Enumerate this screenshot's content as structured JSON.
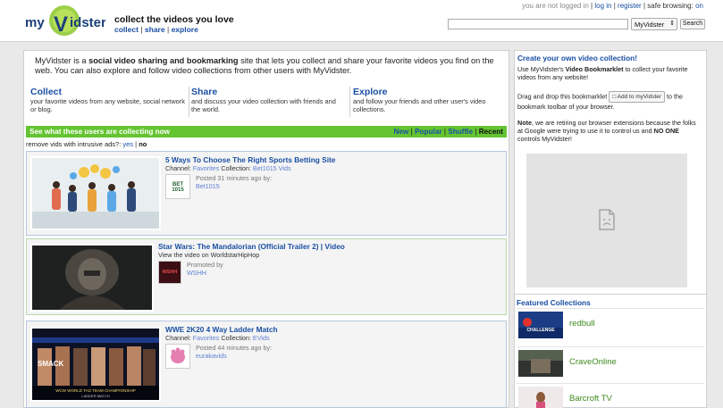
{
  "brand": {
    "logo_text": "myVidster",
    "tagline": "collect the videos you love"
  },
  "nav": {
    "links": [
      "collect",
      "share",
      "explore"
    ],
    "sep": "|"
  },
  "userbar": {
    "status": "you are not logged in",
    "login": "log in",
    "register": "register",
    "safe_label": "safe browsing:",
    "safe_value": "on"
  },
  "search": {
    "placeholder": "",
    "collection_select": "MyVidster",
    "button": "Search"
  },
  "intro": {
    "p1": "MyVidster is a ",
    "bold": "social video sharing and bookmarking",
    "p2": " site that lets you collect and share your favorite videos you find on the web. You can also explore and follow video collections from other users with MyVidster."
  },
  "features": [
    {
      "title": "Collect",
      "desc": "your favorite videos from any website, social network or blog."
    },
    {
      "title": "Share",
      "desc": "and discuss your video collection with friends and the world."
    },
    {
      "title": "Explore",
      "desc": "and follow your friends and other user's video collections."
    }
  ],
  "feed": {
    "header": "See what these users are collecting now",
    "tabs": [
      "New",
      "Popular",
      "Shuffle",
      "Recent"
    ],
    "remove_label": "remove vids with intrusive ads?:",
    "remove_yes": "yes",
    "remove_no": "no"
  },
  "items": [
    {
      "title": "5 Ways To Choose The Right Sports Betting Site",
      "channel_label": "Channel:",
      "channel": "Favorites",
      "collection_label": "Collection:",
      "collection": "Bet1015 Vids",
      "posted": "Posted 31 minutes ago by:",
      "user": "Bet1015",
      "avatar_text": "BET 1015"
    },
    {
      "title": "Star Wars: The Mandalorian (Official Trailer 2) | Video",
      "subtitle": "View the video on WorldstarHipHop",
      "posted": "Promoted by",
      "user": "WSHH",
      "avatar_text": "WSHH"
    },
    {
      "title": "WWE 2K20 4 Way Ladder Match",
      "channel_label": "Channel:",
      "channel": "Favorites",
      "collection_label": "Collection:",
      "collection": "EVids",
      "posted": "Posted 44 minutes ago by:",
      "user": "eurakavids",
      "thumb_caption": "WCW WORLD TAG TEAM CHAMPIONSHIP",
      "thumb_caption2": "LADDER MATCH"
    }
  ],
  "sidebar": {
    "title": "Create your own video collection!",
    "p1a": "Use MyVidster's ",
    "p1b": "Video Bookmarklet",
    "p1c": " to collect your favorite videos from any website!",
    "p2a": "Drag and drop this bookmarklet",
    "bookmarklet": "Add to myVidster",
    "p2b": " to the bookmark toolbar of your browser.",
    "p3a": "Note",
    "p3b": ", we are retiring our browser extensions because the folks at Google were trying to use it to control us and ",
    "p3c": "NO ONE",
    "p3d": " controls MyVidster!",
    "featured_title": "Featured Collections",
    "featured": [
      {
        "name": "redbull",
        "thumb_text": "CHALLENGE"
      },
      {
        "name": "CraveOnline"
      },
      {
        "name": "Barcroft TV"
      }
    ]
  },
  "colors": {
    "accent_blue": "#1a4fa3",
    "green_bar": "#64c431",
    "featured_green": "#3c8a1c"
  }
}
